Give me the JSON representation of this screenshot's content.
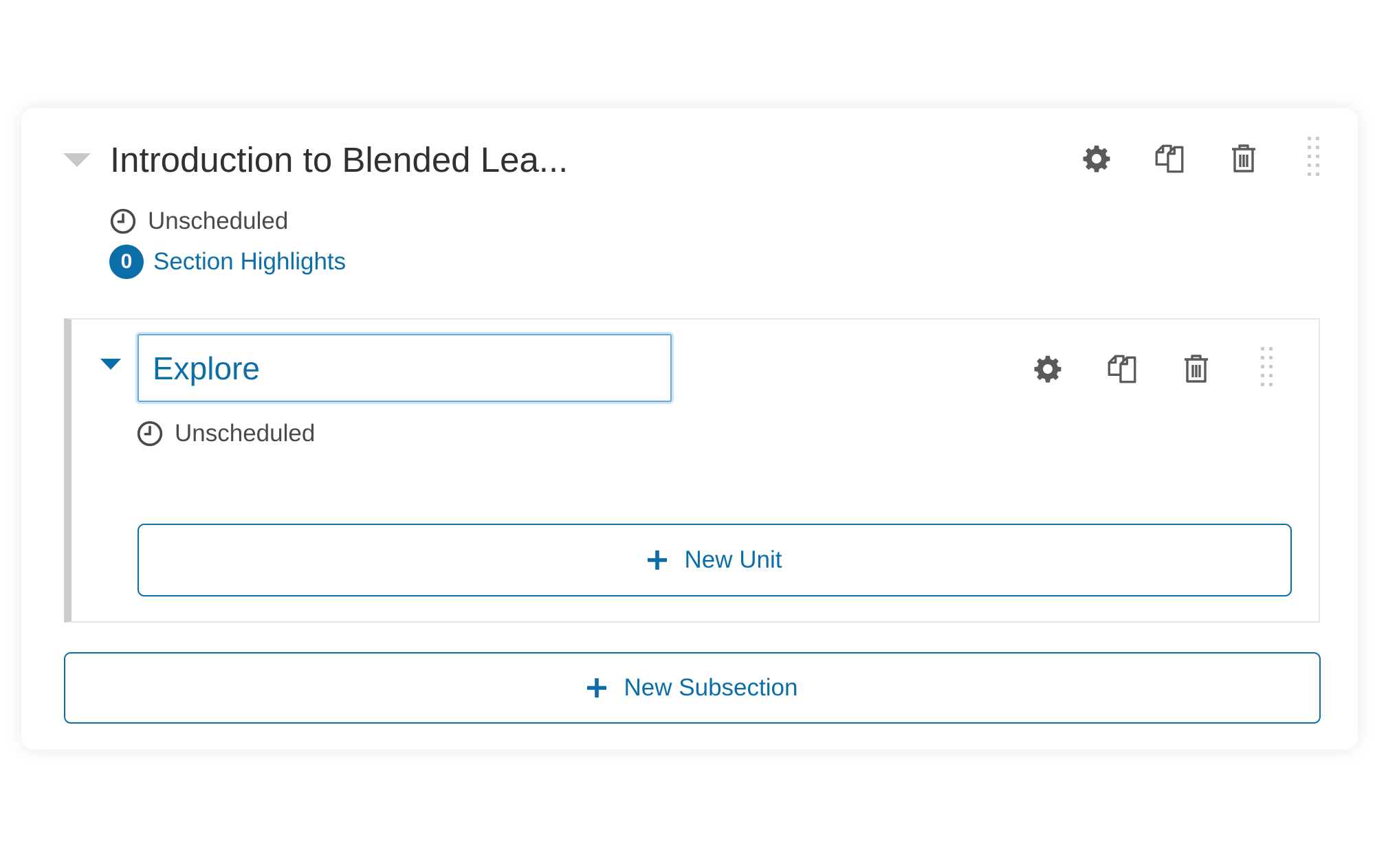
{
  "section": {
    "title": "Introduction to Blended Lea...",
    "status": "Unscheduled",
    "highlights_count": "0",
    "highlights_label": "Section Highlights",
    "actions": [
      "settings",
      "duplicate",
      "delete",
      "drag"
    ]
  },
  "subsection": {
    "name_value": "Explore",
    "status": "Unscheduled",
    "add_unit_label": "New Unit"
  },
  "add_subsection_label": "New Subsection",
  "icons": {
    "settings": "gear-icon",
    "duplicate": "duplicate-icon",
    "delete": "trash-icon",
    "drag": "drag-handle-icon",
    "status": "clock-icon",
    "add": "plus-icon",
    "expand": "chevron-down-icon"
  },
  "colors": {
    "accent": "#0b6ea8",
    "text": "#313131",
    "muted": "#4a4a4a",
    "icon": "#5a5a5a",
    "input_border": "#66a9d6",
    "rail": "#cccccc"
  }
}
